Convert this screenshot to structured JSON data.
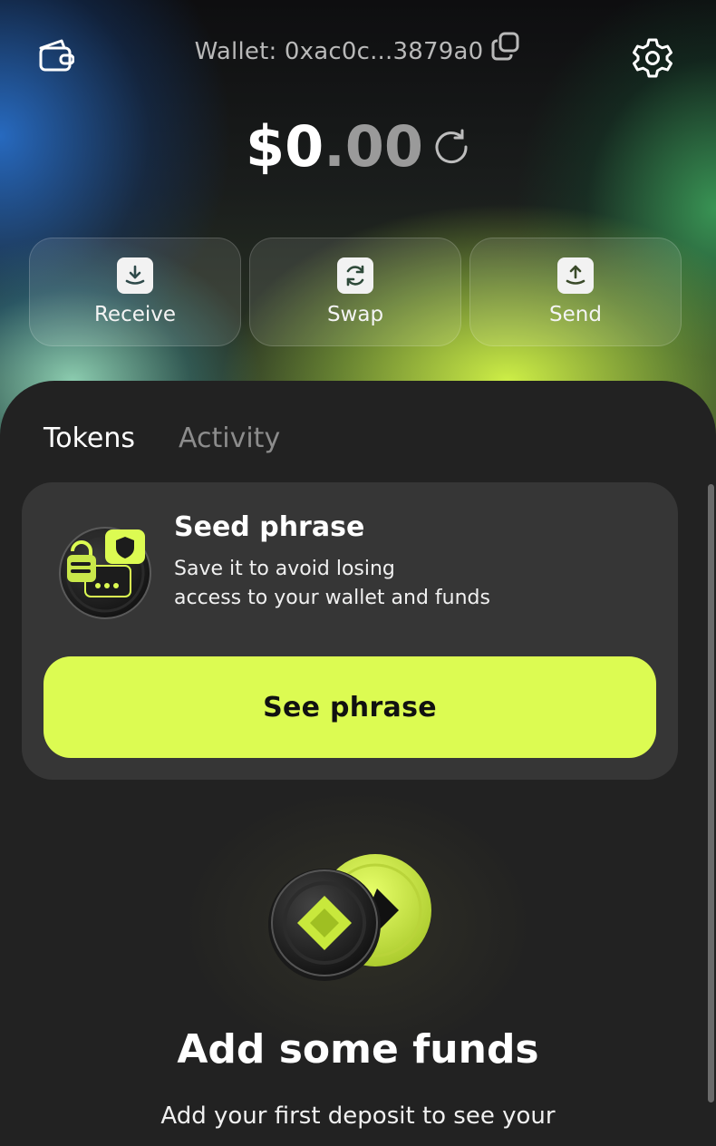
{
  "header": {
    "wallet_label": "Wallet: 0xac0c...3879a0",
    "wallet_icon": "wallet-icon",
    "copy_icon": "copy-icon",
    "settings_icon": "gear-icon"
  },
  "balance": {
    "whole": "$0",
    "decimals": ".00",
    "refresh_icon": "refresh-icon"
  },
  "actions": [
    {
      "label": "Receive",
      "icon": "download-icon"
    },
    {
      "label": "Swap",
      "icon": "swap-icon"
    },
    {
      "label": "Send",
      "icon": "upload-icon"
    }
  ],
  "tabs": [
    {
      "label": "Tokens",
      "active": true
    },
    {
      "label": "Activity",
      "active": false
    }
  ],
  "seed_card": {
    "title": "Seed phrase",
    "description_line1": "Save it to avoid losing",
    "description_line2": "access to your wallet and funds",
    "button_label": "See phrase"
  },
  "empty_state": {
    "title": "Add some funds",
    "description": "Add your first deposit to see your"
  },
  "colors": {
    "accent": "#dcfb52",
    "card": "#363636",
    "sheet": "#222222"
  }
}
